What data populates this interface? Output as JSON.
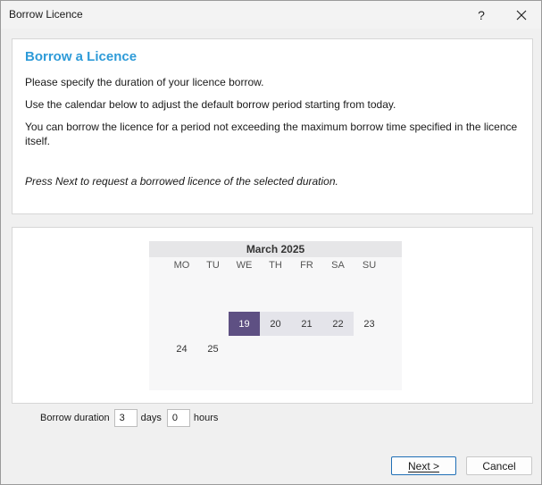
{
  "window": {
    "title": "Borrow Licence",
    "help_label": "?"
  },
  "intro": {
    "heading": "Borrow a Licence",
    "line1": "Please specify the duration of your licence borrow.",
    "line2": "Use the calendar below to adjust the default borrow period starting from today.",
    "line3": "You can borrow the licence for a period not exceeding the maximum borrow time specified in the licence itself.",
    "line4": "Press Next to request a borrowed licence of the selected duration."
  },
  "calendar": {
    "month_label": "March 2025",
    "weekdays": [
      "MO",
      "TU",
      "WE",
      "TH",
      "FR",
      "SA",
      "SU"
    ],
    "days": [
      {
        "label": "19",
        "state": "selected"
      },
      {
        "label": "20",
        "state": "inrange"
      },
      {
        "label": "21",
        "state": "inrange"
      },
      {
        "label": "22",
        "state": "inrange"
      },
      {
        "label": "23",
        "state": "normal"
      },
      {
        "label": "24",
        "state": "normal"
      },
      {
        "label": "25",
        "state": "normal"
      }
    ],
    "selected_color": "#5e5083",
    "range_color": "#e4e4ea"
  },
  "duration": {
    "label": "Borrow duration",
    "days_value": "3",
    "days_label": "days",
    "hours_value": "0",
    "hours_label": "hours"
  },
  "buttons": {
    "next_label": "Next >",
    "cancel_label": "Cancel"
  },
  "colors": {
    "heading": "#2e9bd8",
    "default_button_border": "#1f6fb6"
  }
}
